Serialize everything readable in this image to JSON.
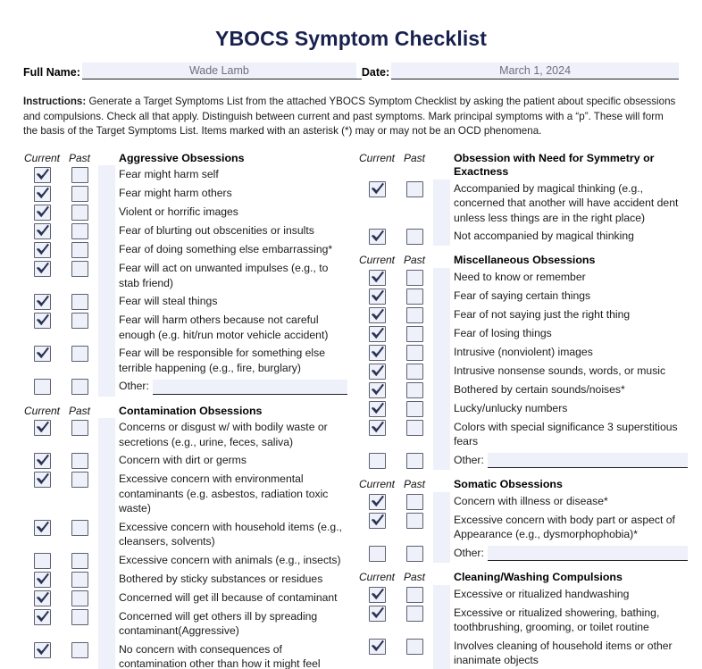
{
  "document": {
    "title": "YBOCS Symptom Checklist",
    "title_color": "#18214d",
    "field_fill_color": "#eef0fa",
    "checkbox_border_color": "#5c6070"
  },
  "identity": {
    "name_label": "Full Name:",
    "name_value": "Wade Lamb",
    "date_label": "Date:",
    "date_value": "March 1, 2024"
  },
  "instructions": {
    "label": "Instructions:",
    "text": " Generate a Target Symptoms List from the attached YBOCS Symptom Checklist by asking the patient about specific obsessions and compulsions. Check all that apply. Distinguish between current and past symptoms. Mark principal symptoms with a “p”. These will form the basis of the Target Symptoms List. Items marked with an asterisk (*) may or may not be an OCD phenomena."
  },
  "column_headers": {
    "current": "Current",
    "past": "Past"
  },
  "other_label": "Other:",
  "left_column": {
    "sections": [
      {
        "title": "Aggressive Obsessions",
        "items": [
          {
            "label": "Fear might harm self",
            "current": true,
            "past": false
          },
          {
            "label": "Fear might harm others",
            "current": true,
            "past": false
          },
          {
            "label": "Violent or horrific images",
            "current": true,
            "past": false
          },
          {
            "label": "Fear of blurting out obscenities or insults",
            "current": true,
            "past": false
          },
          {
            "label": "Fear of doing something else embarrassing*",
            "current": true,
            "past": false
          },
          {
            "label": "Fear will act on unwanted impulses (e.g., to stab friend)",
            "current": true,
            "past": false
          },
          {
            "label": "Fear will steal things",
            "current": true,
            "past": false
          },
          {
            "label": "Fear will harm others because not careful enough (e.g. hit/run motor vehicle accident)",
            "current": true,
            "past": false
          },
          {
            "label": "Fear will be responsible for something else terrible happening (e.g., fire, burglary)",
            "current": true,
            "past": false
          },
          {
            "label": "Other:",
            "current": false,
            "past": false,
            "is_other": true
          }
        ]
      },
      {
        "title": "Contamination Obsessions",
        "items": [
          {
            "label": "Concerns or disgust w/ with bodily waste or secretions (e.g., urine, feces, saliva)",
            "current": true,
            "past": false
          },
          {
            "label": "Concern with dirt or germs",
            "current": true,
            "past": false
          },
          {
            "label": "Excessive concern with environmental contaminants (e.g. asbestos, radiation toxic waste)",
            "current": true,
            "past": false
          },
          {
            "label": "Excessive concern with household items (e.g., cleansers, solvents)",
            "current": true,
            "past": false
          },
          {
            "label": "Excessive concern with animals (e.g., insects)",
            "current": false,
            "past": false
          },
          {
            "label": "Bothered by sticky substances or residues",
            "current": true,
            "past": false
          },
          {
            "label": "Concerned will get ill because of contaminant",
            "current": true,
            "past": false
          },
          {
            "label": "Concerned will get others ill by spreading contaminant(Aggressive)",
            "current": true,
            "past": false
          },
          {
            "label": "No concern with consequences of contamination other than how it might feel",
            "current": true,
            "past": false
          }
        ]
      }
    ]
  },
  "right_column": {
    "sections": [
      {
        "title": "Obsession with Need for Symmetry or Exactness",
        "items": [
          {
            "label": "Accompanied by magical thinking (e.g., concerned that another will have accident dent unless less things are in the right place)",
            "current": true,
            "past": false
          },
          {
            "label": "Not accompanied by magical thinking",
            "current": true,
            "past": false
          }
        ]
      },
      {
        "title": "Miscellaneous Obsessions",
        "items": [
          {
            "label": "Need to know or remember",
            "current": true,
            "past": false
          },
          {
            "label": "Fear of saying certain things",
            "current": true,
            "past": false
          },
          {
            "label": "Fear of not saying just the right thing",
            "current": true,
            "past": false
          },
          {
            "label": "Fear of losing things",
            "current": true,
            "past": false
          },
          {
            "label": "Intrusive (nonviolent) images",
            "current": true,
            "past": false
          },
          {
            "label": "Intrusive nonsense sounds, words, or music",
            "current": true,
            "past": false
          },
          {
            "label": "Bothered by certain sounds/noises*",
            "current": true,
            "past": false
          },
          {
            "label": "Lucky/unlucky numbers",
            "current": true,
            "past": false
          },
          {
            "label": "Colors with special significance 3 superstitious fears",
            "current": true,
            "past": false
          },
          {
            "label": "Other:",
            "current": false,
            "past": false,
            "is_other": true
          }
        ]
      },
      {
        "title": "Somatic Obsessions",
        "items": [
          {
            "label": "Concern with illness or disease*",
            "current": true,
            "past": false
          },
          {
            "label": "Excessive concern with body part or aspect of Appearance (e.g., dysmorphophobia)*",
            "current": true,
            "past": false
          },
          {
            "label": "Other:",
            "current": false,
            "past": false,
            "is_other": true
          }
        ]
      },
      {
        "title": "Cleaning/Washing Compulsions",
        "items": [
          {
            "label": "Excessive or ritualized handwashing",
            "current": true,
            "past": false
          },
          {
            "label": "Excessive or ritualized showering, bathing, toothbrushing, grooming, or toilet routine",
            "current": true,
            "past": false
          },
          {
            "label": "Involves cleaning of household items or other inanimate objects",
            "current": true,
            "past": false
          }
        ]
      }
    ]
  }
}
